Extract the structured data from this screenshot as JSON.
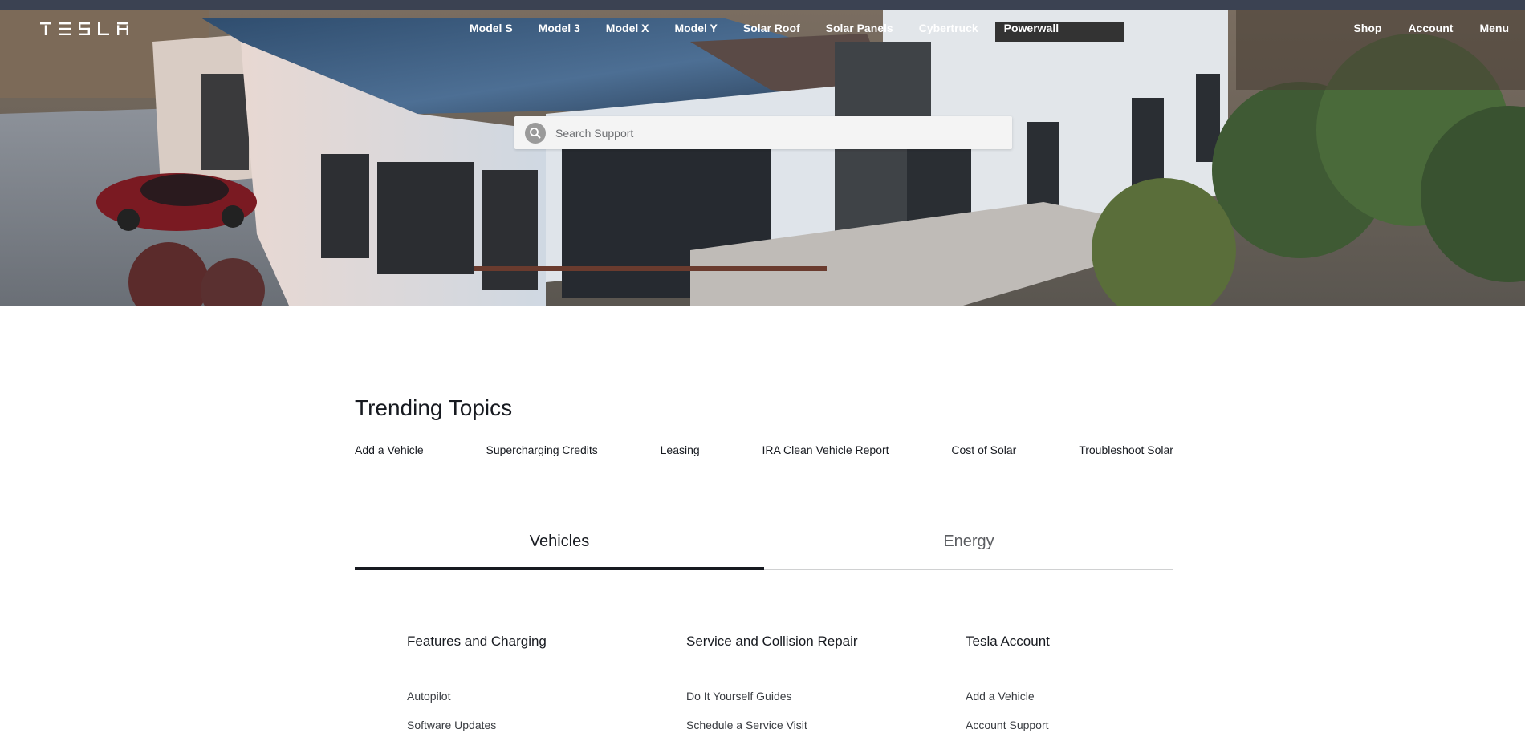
{
  "brand": {
    "logo_text": "TESLA"
  },
  "nav": {
    "center": [
      "Model S",
      "Model 3",
      "Model X",
      "Model Y",
      "Solar Roof",
      "Solar Panels",
      "Cybertruck",
      "Powerwall"
    ],
    "right": [
      "Shop",
      "Account",
      "Menu"
    ]
  },
  "search": {
    "placeholder": "Search Support"
  },
  "trending": {
    "title": "Trending Topics",
    "items": [
      "Add a Vehicle",
      "Supercharging Credits",
      "Leasing",
      "IRA Clean Vehicle Report",
      "Cost of Solar",
      "Troubleshoot Solar"
    ]
  },
  "tabs": {
    "active": "Vehicles",
    "inactive": "Energy"
  },
  "sections": [
    {
      "title": "Features and Charging",
      "links": [
        "Autopilot",
        "Software Updates"
      ]
    },
    {
      "title": "Service and Collision Repair",
      "links": [
        "Do It Yourself Guides",
        "Schedule a Service Visit"
      ]
    },
    {
      "title": "Tesla Account",
      "links": [
        "Add a Vehicle",
        "Account Support"
      ]
    }
  ],
  "icons": {
    "search": "search-icon"
  },
  "colors": {
    "text": "#171a20",
    "muted": "#5c5e62",
    "tab_underline": "#171a20"
  }
}
